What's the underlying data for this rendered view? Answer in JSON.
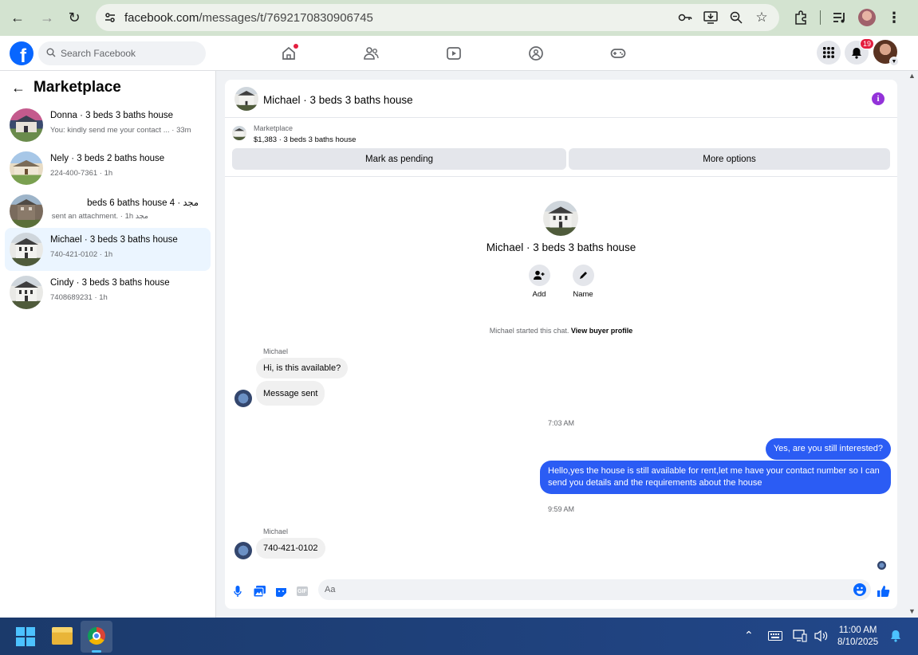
{
  "browser": {
    "url_host": "facebook.com",
    "url_path": "/messages/t/7692170830906745"
  },
  "fb_header": {
    "search_placeholder": "Search Facebook",
    "notification_count": "19"
  },
  "sidebar": {
    "title": "Marketplace",
    "conversations": [
      {
        "name": "Donna · 3 beds 3 baths house",
        "preview": "You: kindly send me your contact ... · 33m",
        "active": false
      },
      {
        "name": "Nely · 3 beds 2 baths house",
        "preview": "224-400-7361 · 1h",
        "active": false
      },
      {
        "name": "مجد · 4 beds 6 baths house",
        "preview": "مجد sent an attachment. · 1h",
        "active": false
      },
      {
        "name": "Michael · 3 beds 3 baths house",
        "preview": "740-421-0102 · 1h",
        "active": true
      },
      {
        "name": "Cindy · 3 beds 3 baths house",
        "preview": "7408689231 · 1h",
        "active": false
      }
    ]
  },
  "chat": {
    "header_title": "Michael · 3 beds 3 baths house",
    "listing": {
      "category": "Marketplace",
      "price_line": "$1,383 · 3 beds 3 baths house",
      "mark_pending_label": "Mark as pending",
      "more_options_label": "More options"
    },
    "profile_name": "Michael · 3 beds 3 baths house",
    "actions": [
      {
        "label": "Add"
      },
      {
        "label": "Name"
      }
    ],
    "started_text": "Michael started this chat.",
    "view_profile_link": "View buyer profile",
    "messages": {
      "sender1": "Michael",
      "in1": "Hi, is this available?",
      "in2": "Message sent",
      "time1": "7:03 AM",
      "out1": "Yes, are you still interested?",
      "out2": "Hello,yes the house is still available for rent,let me have your contact number   so I can send you details and the requirements about the house",
      "time2": "9:59 AM",
      "sender2": "Michael",
      "in3": "740-421-0102"
    },
    "composer_placeholder": "Aa",
    "gif_label": "GIF"
  },
  "taskbar": {
    "time": "11:00 AM",
    "date": "8/10/2025"
  }
}
